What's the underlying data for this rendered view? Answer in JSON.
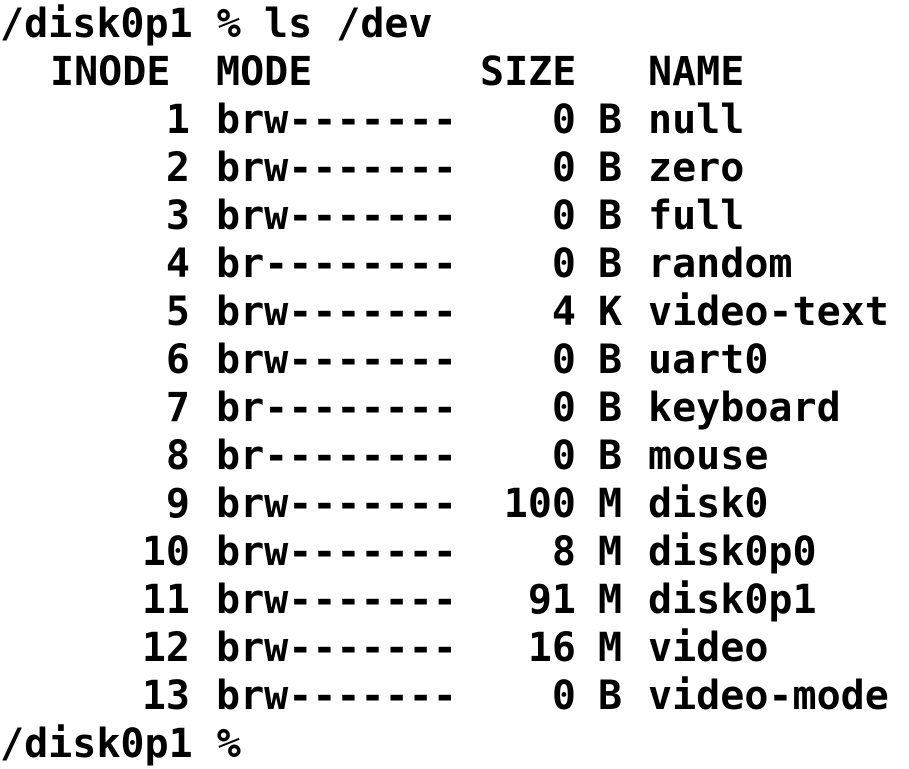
{
  "terminal": {
    "command_line": {
      "prompt": "/disk0p1 %",
      "command": "ls /dev"
    },
    "headers": {
      "inode": "INODE",
      "mode": "MODE",
      "size": "SIZE",
      "name": "NAME"
    },
    "rows": [
      {
        "inode": "1",
        "mode": "brw-------",
        "size": "0",
        "unit": "B",
        "name": "null"
      },
      {
        "inode": "2",
        "mode": "brw-------",
        "size": "0",
        "unit": "B",
        "name": "zero"
      },
      {
        "inode": "3",
        "mode": "brw-------",
        "size": "0",
        "unit": "B",
        "name": "full"
      },
      {
        "inode": "4",
        "mode": "br--------",
        "size": "0",
        "unit": "B",
        "name": "random"
      },
      {
        "inode": "5",
        "mode": "brw-------",
        "size": "4",
        "unit": "K",
        "name": "video-text"
      },
      {
        "inode": "6",
        "mode": "brw-------",
        "size": "0",
        "unit": "B",
        "name": "uart0"
      },
      {
        "inode": "7",
        "mode": "br--------",
        "size": "0",
        "unit": "B",
        "name": "keyboard"
      },
      {
        "inode": "8",
        "mode": "br--------",
        "size": "0",
        "unit": "B",
        "name": "mouse"
      },
      {
        "inode": "9",
        "mode": "brw-------",
        "size": "100",
        "unit": "M",
        "name": "disk0"
      },
      {
        "inode": "10",
        "mode": "brw-------",
        "size": "8",
        "unit": "M",
        "name": "disk0p0"
      },
      {
        "inode": "11",
        "mode": "brw-------",
        "size": "91",
        "unit": "M",
        "name": "disk0p1"
      },
      {
        "inode": "12",
        "mode": "brw-------",
        "size": "16",
        "unit": "M",
        "name": "video"
      },
      {
        "inode": "13",
        "mode": "brw-------",
        "size": "0",
        "unit": "B",
        "name": "video-mode"
      }
    ],
    "final_prompt": "/disk0p1 %"
  }
}
